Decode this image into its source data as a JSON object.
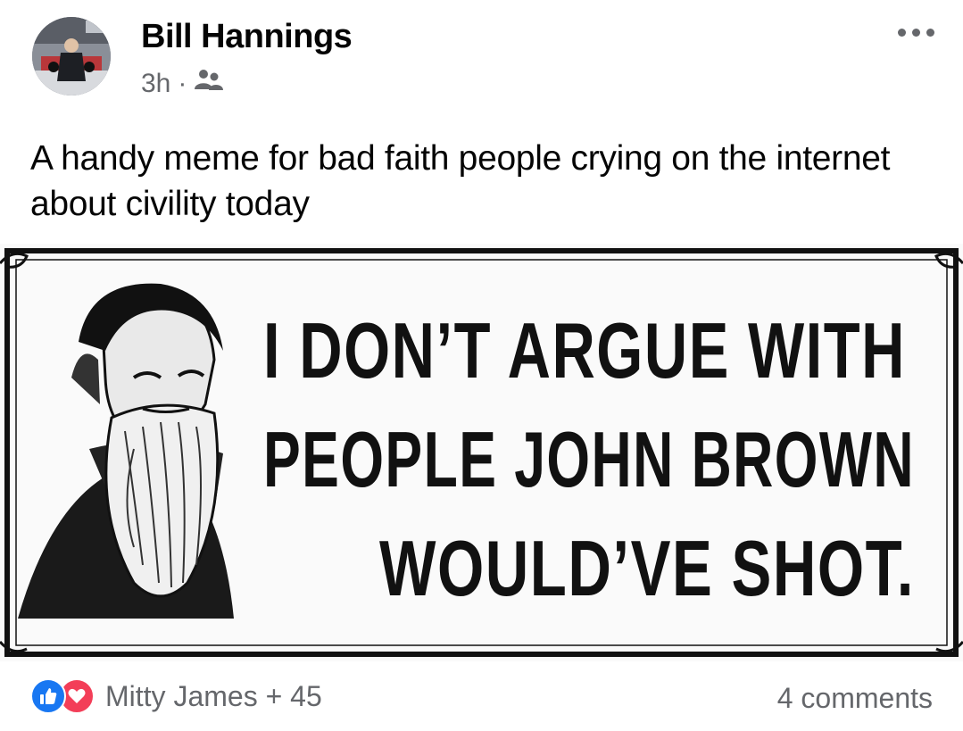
{
  "post": {
    "author": "Bill Hannings",
    "time": "3h",
    "separator": "·",
    "audience_icon": "friends-icon",
    "text": "A handy meme for bad faith people crying on the internet about civility today"
  },
  "meme": {
    "lines": [
      "I DON’T ARGUE WITH",
      "PEOPLE JOHN BROWN",
      "WOULD’VE SHOT."
    ]
  },
  "footer": {
    "reaction_icons": [
      "like-icon",
      "love-icon"
    ],
    "reactors": "Mitty James + 45",
    "comments": "4 comments"
  },
  "colors": {
    "like": "#1877f2",
    "love": "#f33e58",
    "secondary_text": "#65676b"
  }
}
